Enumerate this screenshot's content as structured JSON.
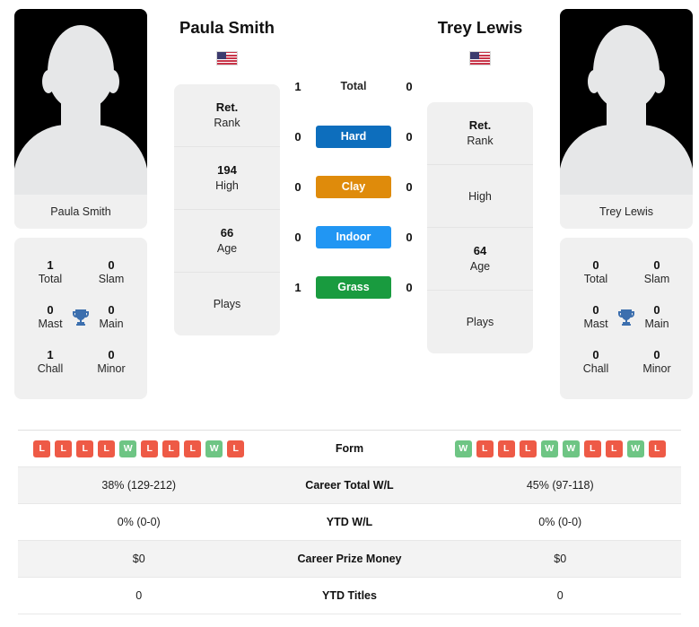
{
  "players": {
    "left": {
      "name": "Paula Smith",
      "photo_caption": "Paula Smith",
      "flag": "us-flag-icon",
      "titles": {
        "total": "1",
        "total_label": "Total",
        "slam": "0",
        "slam_label": "Slam",
        "mast": "0",
        "mast_label": "Mast",
        "main": "0",
        "main_label": "Main",
        "chall": "1",
        "chall_label": "Chall",
        "minor": "0",
        "minor_label": "Minor",
        "trophy_icon": "trophy-icon"
      },
      "info": [
        {
          "value": "Ret.",
          "label": "Rank"
        },
        {
          "value": "194",
          "label": "High"
        },
        {
          "value": "66",
          "label": "Age"
        },
        {
          "value": "",
          "label": "Plays"
        }
      ],
      "surface": {
        "total": "1",
        "hard": "0",
        "clay": "0",
        "indoor": "0",
        "grass": "1"
      },
      "form": [
        "L",
        "L",
        "L",
        "L",
        "W",
        "L",
        "L",
        "L",
        "W",
        "L"
      ],
      "career_total_wl": "38% (129-212)",
      "ytd_wl": "0% (0-0)",
      "career_prize_money": "$0",
      "ytd_titles": "0"
    },
    "right": {
      "name": "Trey Lewis",
      "photo_caption": "Trey Lewis",
      "flag": "us-flag-icon",
      "titles": {
        "total": "0",
        "total_label": "Total",
        "slam": "0",
        "slam_label": "Slam",
        "mast": "0",
        "mast_label": "Mast",
        "main": "0",
        "main_label": "Main",
        "chall": "0",
        "chall_label": "Chall",
        "minor": "0",
        "minor_label": "Minor",
        "trophy_icon": "trophy-icon"
      },
      "info": [
        {
          "value": "Ret.",
          "label": "Rank"
        },
        {
          "value": "",
          "label": "High"
        },
        {
          "value": "64",
          "label": "Age"
        },
        {
          "value": "",
          "label": "Plays"
        }
      ],
      "surface": {
        "total": "0",
        "hard": "0",
        "clay": "0",
        "indoor": "0",
        "grass": "0"
      },
      "form": [
        "W",
        "L",
        "L",
        "L",
        "W",
        "W",
        "L",
        "L",
        "W",
        "L"
      ],
      "career_total_wl": "45% (97-118)",
      "ytd_wl": "0% (0-0)",
      "career_prize_money": "$0",
      "ytd_titles": "0"
    }
  },
  "surface_rows": [
    {
      "key": "total",
      "label": "Total",
      "style": "plain",
      "color": ""
    },
    {
      "key": "hard",
      "label": "Hard",
      "style": "badge",
      "color": "#0d6ebd"
    },
    {
      "key": "clay",
      "label": "Clay",
      "style": "badge",
      "color": "#df8b0b"
    },
    {
      "key": "indoor",
      "label": "Indoor",
      "style": "badge",
      "color": "#2196f3"
    },
    {
      "key": "grass",
      "label": "Grass",
      "style": "badge",
      "color": "#199b3f"
    }
  ],
  "stats_rows": [
    {
      "label": "Form",
      "key": "form",
      "type": "form"
    },
    {
      "label": "Career Total W/L",
      "key": "career_total_wl",
      "type": "text"
    },
    {
      "label": "YTD W/L",
      "key": "ytd_wl",
      "type": "text"
    },
    {
      "label": "Career Prize Money",
      "key": "career_prize_money",
      "type": "text"
    },
    {
      "label": "YTD Titles",
      "key": "ytd_titles",
      "type": "text"
    }
  ],
  "colors": {
    "win_badge": "#6ec584",
    "loss_badge": "#ee5a46",
    "trophy": "#3c6fae",
    "card_bg": "#f0f0f0",
    "row_alt_bg": "#f3f3f3"
  }
}
